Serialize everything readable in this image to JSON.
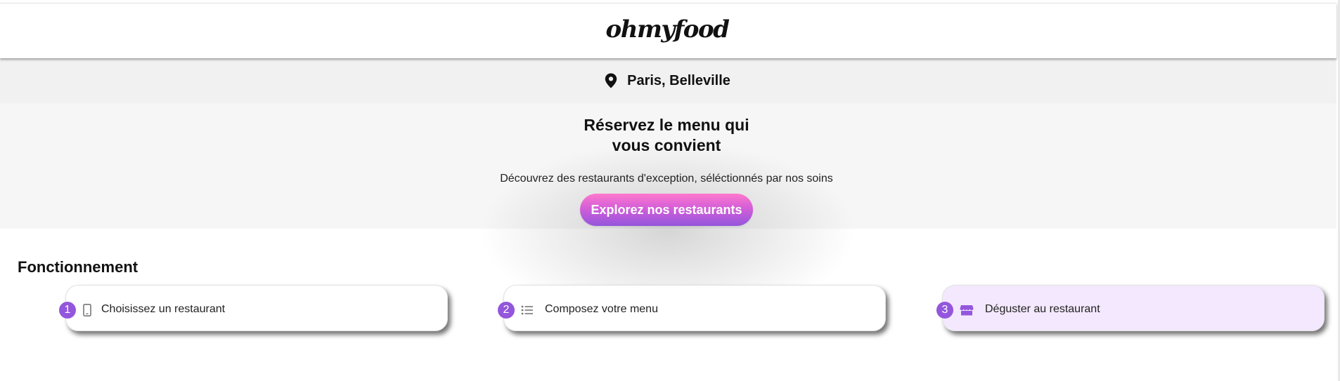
{
  "header": {
    "logo": "ohmyfood"
  },
  "location": {
    "icon": "map-pin-icon",
    "text": "Paris, Belleville"
  },
  "hero": {
    "title_line1": "Réservez le menu qui",
    "title_line2": "vous convient",
    "subtitle": "Découvrez des restaurants d'exception, séléctionnés par nos soins",
    "cta_label": "Explorez nos restaurants"
  },
  "section": {
    "title": "Fonctionnement",
    "steps": [
      {
        "number": "1",
        "icon": "smartphone-icon",
        "label": "Choisissez un restaurant"
      },
      {
        "number": "2",
        "icon": "list-icon",
        "label": "Composez votre menu"
      },
      {
        "number": "3",
        "icon": "store-icon",
        "label": "Déguster au restaurant"
      }
    ]
  },
  "colors": {
    "accent_purple": "#9356dc",
    "accent_pink": "#ff79cd",
    "highlight_card": "#f3e8fd",
    "location_bg": "#f1f1f1",
    "hero_bg": "#f6f6f6"
  }
}
